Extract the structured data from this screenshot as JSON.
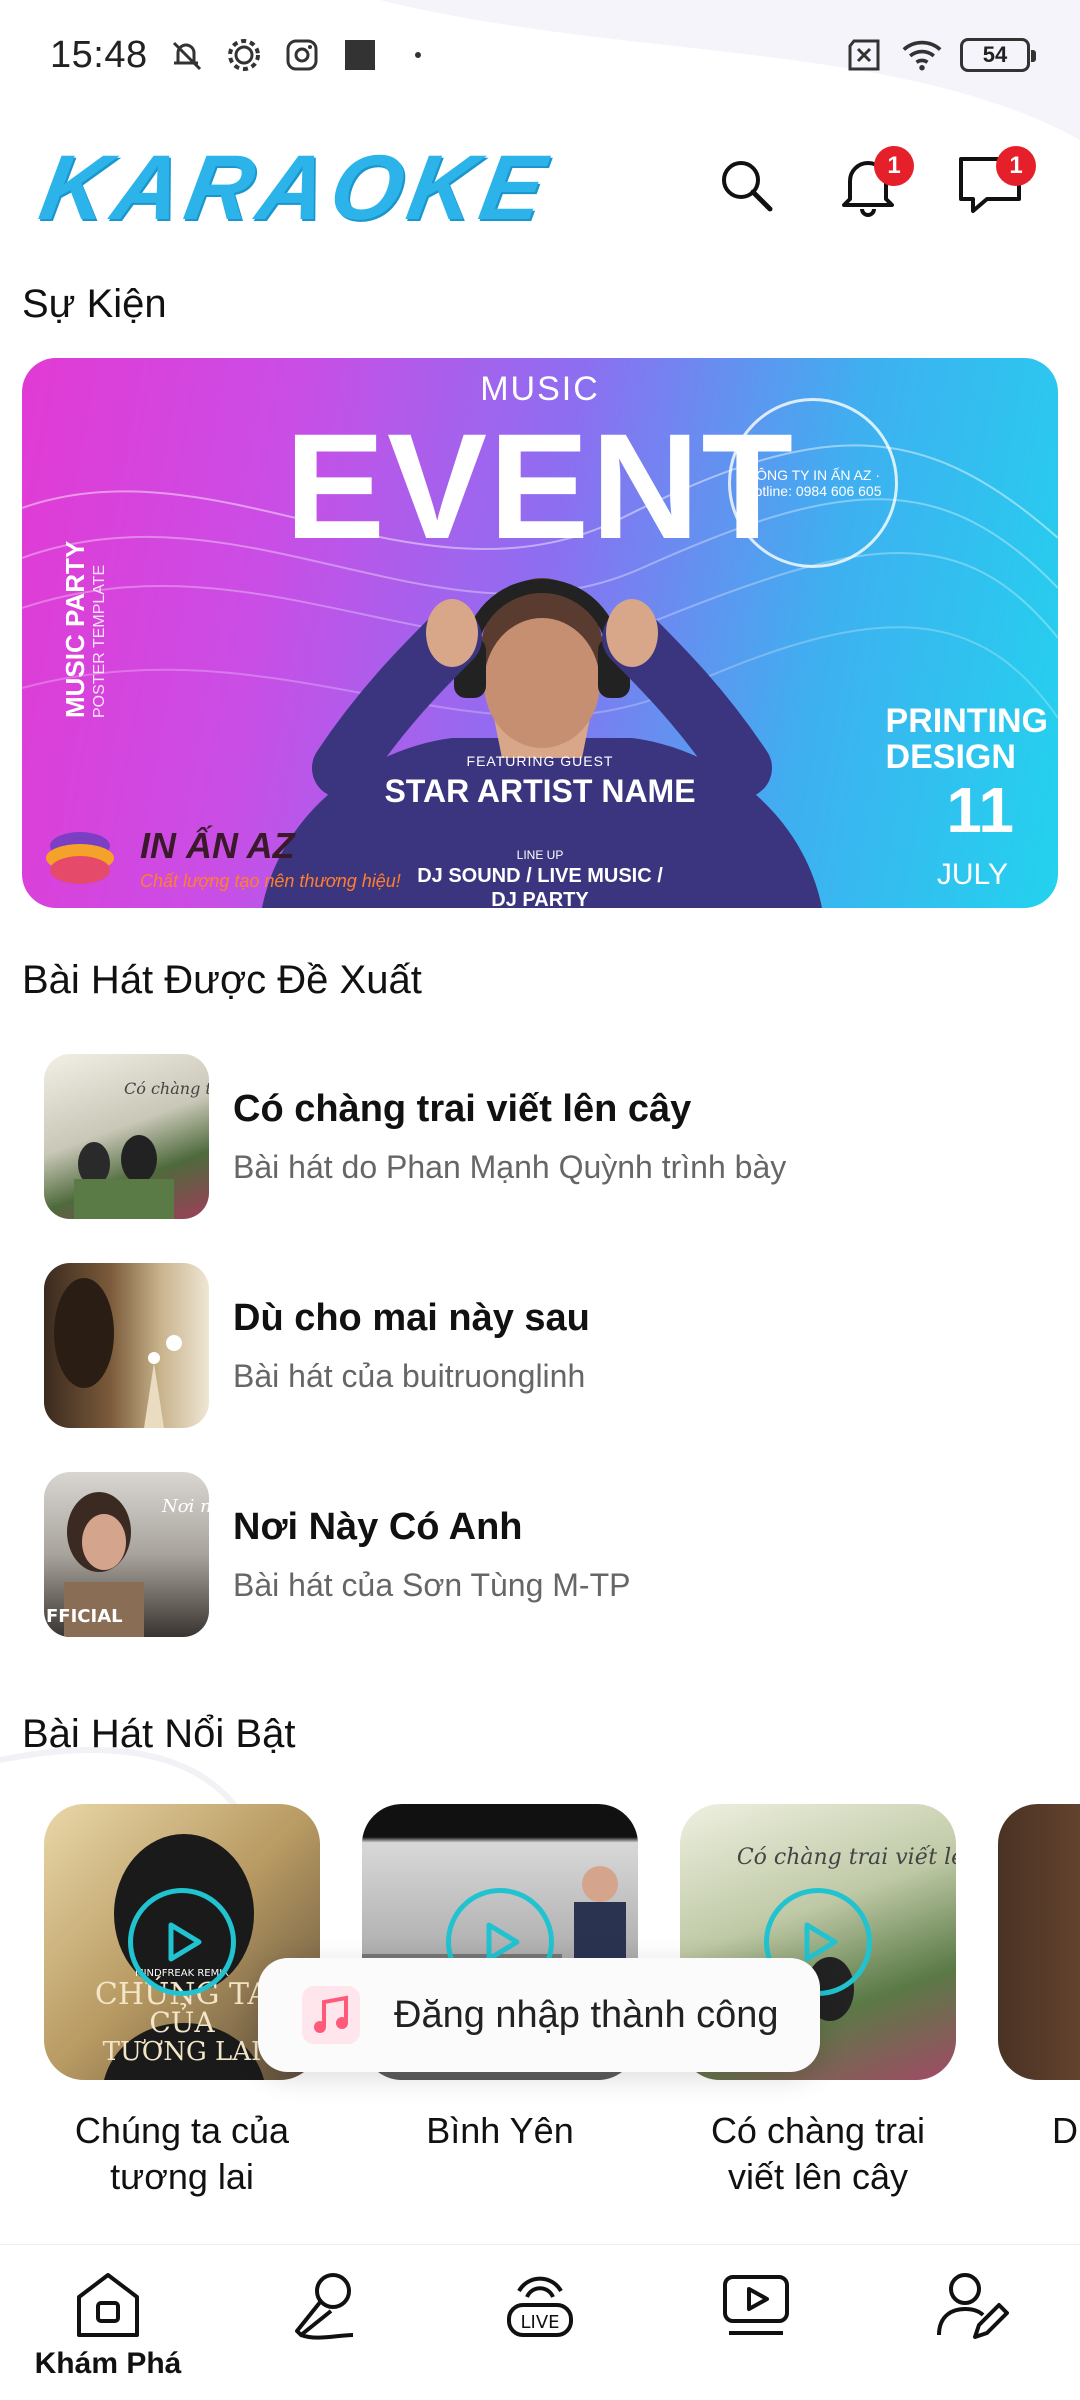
{
  "status_bar": {
    "time": "15:48",
    "battery": "54",
    "icons": [
      "mute-icon",
      "gear-icon",
      "instagram-icon",
      "square-icon",
      "dot-icon",
      "sim-off-icon",
      "wifi-icon",
      "battery-icon"
    ]
  },
  "header": {
    "logo": "KARAOKE",
    "notification_count": "1",
    "message_count": "1",
    "icons": [
      "search-icon",
      "bell-icon",
      "chat-icon"
    ]
  },
  "sections": {
    "events_title": "Sự Kiện",
    "recommended_title": "Bài Hát Được Đề Xuất",
    "featured_title": "Bài Hát Nổi Bật"
  },
  "event_banner": {
    "music": "MUSIC",
    "title": "EVENT",
    "side_title": "MUSIC PARTY",
    "side_subtitle": "POSTER TEMPLATE",
    "featuring": "FEATURING GUEST",
    "artist": "STAR ARTIST NAME",
    "lineup": "LINE UP",
    "djs": "DJ SOUND / LIVE MUSIC / DJ PARTY",
    "printing_1": "PRINTING",
    "printing_2": "DESIGN",
    "date": "11",
    "month": "JULY",
    "stamp": "CÔNG TY IN ẤN AZ · Hotline: 0984 606 605",
    "brand_name": "IN ẤN AZ",
    "brand_tag": "Chất lượng tạo nên thương hiệu!"
  },
  "recommended": [
    {
      "title": "Có chàng trai viết lên cây",
      "subtitle": "Bài hát do Phan Mạnh Quỳnh trình bày"
    },
    {
      "title": "Dù cho mai này sau",
      "subtitle": "Bài hát của buitruonglinh"
    },
    {
      "title": "Nơi Này Có Anh",
      "subtitle": "Bài hát của Sơn Tùng M-TP"
    }
  ],
  "featured": [
    {
      "label_1": "Chúng ta của",
      "label_2": "tương lai",
      "thumb_text_1": "CHÚNG TA",
      "thumb_text_2": "CỦA",
      "thumb_text_3": "TƯƠNG LAI",
      "thumb_tag": "MINDFREAK REMIX"
    },
    {
      "label_1": "Bình Yên",
      "label_2": ""
    },
    {
      "label_1": "Có chàng trai",
      "label_2": "viết lên cây"
    },
    {
      "label_1": "Dù",
      "label_2": ""
    }
  ],
  "thumb_texts": {
    "official": "FFICIAL",
    "r1_text": "Có chàng trai viết lên cây",
    "r3_text": "Nơi này có anh"
  },
  "toast": {
    "text": "Đăng nhập thành công",
    "icon": "music-note-icon"
  },
  "bottom_nav": [
    {
      "label": "Khám Phá",
      "icon": "home-icon"
    },
    {
      "label": "",
      "icon": "microphone-icon"
    },
    {
      "label": "",
      "icon": "live-icon"
    },
    {
      "label": "",
      "icon": "video-icon"
    },
    {
      "label": "",
      "icon": "user-edit-icon"
    }
  ],
  "colors": {
    "accent": "#2bb3ea",
    "badge": "#e5202a",
    "play_ring": "#21c3d0"
  }
}
